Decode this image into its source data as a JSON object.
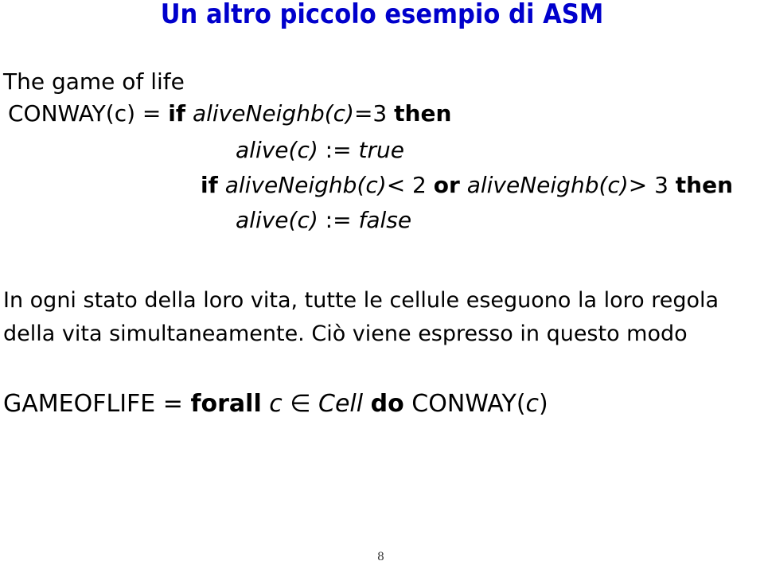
{
  "slide": {
    "title": "Un altro piccolo esempio di ASM",
    "subtitle": "The game of life",
    "conway": {
      "lhs": "CONWAY(c) = ",
      "line1": {
        "kw_if": "if",
        "cond": "aliveNeighb(c)",
        "op": "=3 ",
        "kw_then": "then"
      },
      "line2": {
        "lhs": "alive(c)",
        "op": " := ",
        "val": "true"
      },
      "line3": {
        "kw_if": "if",
        "cond1": "aliveNeighb(c)",
        "op1": "< 2 ",
        "kw_or": "or",
        "cond2": "aliveNeighb(c)",
        "op2": "> 3 ",
        "kw_then": "then"
      },
      "line4": {
        "lhs": "alive(c)",
        "op": " := ",
        "val": "false"
      }
    },
    "paragraph": [
      "In ogni stato della loro vita, tutte le cellule eseguono la loro regola",
      "della vita simultaneamente. Ciò viene espresso in questo modo"
    ],
    "gameoflife": {
      "lhs": "GAMEOFLIFE = ",
      "kw_forall": "forall",
      "var": "c",
      "in": " ∈ ",
      "set": "Cell",
      "kw_do": "do",
      "rhs_pre": "CONWAY(",
      "rhs_var": "c",
      "rhs_post": ")"
    },
    "page_number": "8"
  }
}
